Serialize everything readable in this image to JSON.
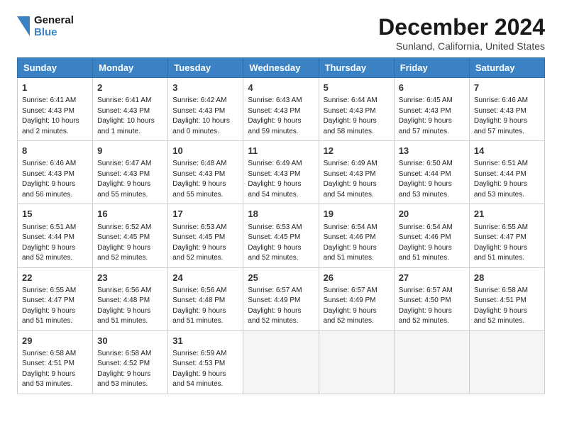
{
  "logo": {
    "line1": "General",
    "line2": "Blue"
  },
  "title": "December 2024",
  "location": "Sunland, California, United States",
  "days_of_week": [
    "Sunday",
    "Monday",
    "Tuesday",
    "Wednesday",
    "Thursday",
    "Friday",
    "Saturday"
  ],
  "weeks": [
    [
      {
        "day": 1,
        "sunrise": "6:41 AM",
        "sunset": "4:43 PM",
        "daylight": "10 hours and 2 minutes."
      },
      {
        "day": 2,
        "sunrise": "6:41 AM",
        "sunset": "4:43 PM",
        "daylight": "10 hours and 1 minute."
      },
      {
        "day": 3,
        "sunrise": "6:42 AM",
        "sunset": "4:43 PM",
        "daylight": "10 hours and 0 minutes."
      },
      {
        "day": 4,
        "sunrise": "6:43 AM",
        "sunset": "4:43 PM",
        "daylight": "9 hours and 59 minutes."
      },
      {
        "day": 5,
        "sunrise": "6:44 AM",
        "sunset": "4:43 PM",
        "daylight": "9 hours and 58 minutes."
      },
      {
        "day": 6,
        "sunrise": "6:45 AM",
        "sunset": "4:43 PM",
        "daylight": "9 hours and 57 minutes."
      },
      {
        "day": 7,
        "sunrise": "6:46 AM",
        "sunset": "4:43 PM",
        "daylight": "9 hours and 57 minutes."
      }
    ],
    [
      {
        "day": 8,
        "sunrise": "6:46 AM",
        "sunset": "4:43 PM",
        "daylight": "9 hours and 56 minutes."
      },
      {
        "day": 9,
        "sunrise": "6:47 AM",
        "sunset": "4:43 PM",
        "daylight": "9 hours and 55 minutes."
      },
      {
        "day": 10,
        "sunrise": "6:48 AM",
        "sunset": "4:43 PM",
        "daylight": "9 hours and 55 minutes."
      },
      {
        "day": 11,
        "sunrise": "6:49 AM",
        "sunset": "4:43 PM",
        "daylight": "9 hours and 54 minutes."
      },
      {
        "day": 12,
        "sunrise": "6:49 AM",
        "sunset": "4:43 PM",
        "daylight": "9 hours and 54 minutes."
      },
      {
        "day": 13,
        "sunrise": "6:50 AM",
        "sunset": "4:44 PM",
        "daylight": "9 hours and 53 minutes."
      },
      {
        "day": 14,
        "sunrise": "6:51 AM",
        "sunset": "4:44 PM",
        "daylight": "9 hours and 53 minutes."
      }
    ],
    [
      {
        "day": 15,
        "sunrise": "6:51 AM",
        "sunset": "4:44 PM",
        "daylight": "9 hours and 52 minutes."
      },
      {
        "day": 16,
        "sunrise": "6:52 AM",
        "sunset": "4:45 PM",
        "daylight": "9 hours and 52 minutes."
      },
      {
        "day": 17,
        "sunrise": "6:53 AM",
        "sunset": "4:45 PM",
        "daylight": "9 hours and 52 minutes."
      },
      {
        "day": 18,
        "sunrise": "6:53 AM",
        "sunset": "4:45 PM",
        "daylight": "9 hours and 52 minutes."
      },
      {
        "day": 19,
        "sunrise": "6:54 AM",
        "sunset": "4:46 PM",
        "daylight": "9 hours and 51 minutes."
      },
      {
        "day": 20,
        "sunrise": "6:54 AM",
        "sunset": "4:46 PM",
        "daylight": "9 hours and 51 minutes."
      },
      {
        "day": 21,
        "sunrise": "6:55 AM",
        "sunset": "4:47 PM",
        "daylight": "9 hours and 51 minutes."
      }
    ],
    [
      {
        "day": 22,
        "sunrise": "6:55 AM",
        "sunset": "4:47 PM",
        "daylight": "9 hours and 51 minutes."
      },
      {
        "day": 23,
        "sunrise": "6:56 AM",
        "sunset": "4:48 PM",
        "daylight": "9 hours and 51 minutes."
      },
      {
        "day": 24,
        "sunrise": "6:56 AM",
        "sunset": "4:48 PM",
        "daylight": "9 hours and 51 minutes."
      },
      {
        "day": 25,
        "sunrise": "6:57 AM",
        "sunset": "4:49 PM",
        "daylight": "9 hours and 52 minutes."
      },
      {
        "day": 26,
        "sunrise": "6:57 AM",
        "sunset": "4:49 PM",
        "daylight": "9 hours and 52 minutes."
      },
      {
        "day": 27,
        "sunrise": "6:57 AM",
        "sunset": "4:50 PM",
        "daylight": "9 hours and 52 minutes."
      },
      {
        "day": 28,
        "sunrise": "6:58 AM",
        "sunset": "4:51 PM",
        "daylight": "9 hours and 52 minutes."
      }
    ],
    [
      {
        "day": 29,
        "sunrise": "6:58 AM",
        "sunset": "4:51 PM",
        "daylight": "9 hours and 53 minutes."
      },
      {
        "day": 30,
        "sunrise": "6:58 AM",
        "sunset": "4:52 PM",
        "daylight": "9 hours and 53 minutes."
      },
      {
        "day": 31,
        "sunrise": "6:59 AM",
        "sunset": "4:53 PM",
        "daylight": "9 hours and 54 minutes."
      },
      null,
      null,
      null,
      null
    ]
  ]
}
